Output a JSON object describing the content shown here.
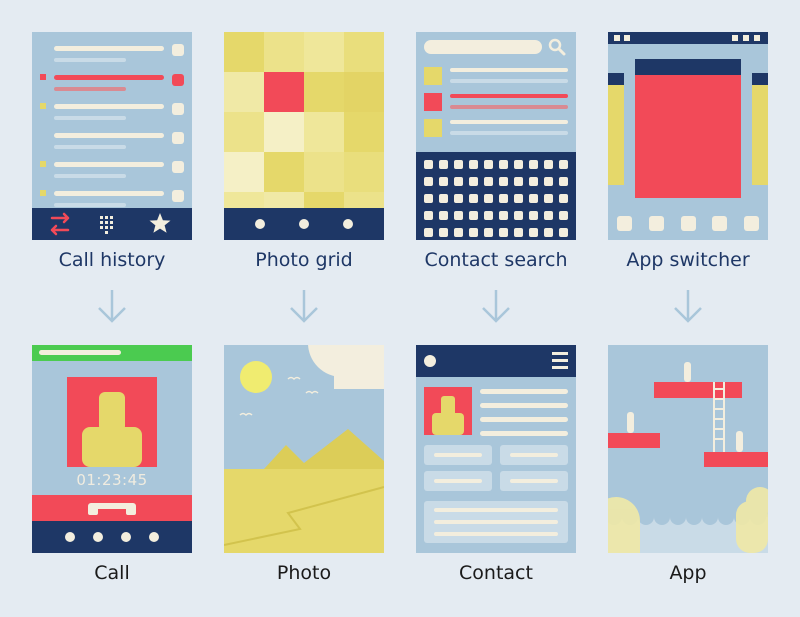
{
  "top_labels": {
    "call_history": "Call history",
    "photo_grid": "Photo grid",
    "contact_search": "Contact search",
    "app_switcher": "App switcher"
  },
  "bottom_labels": {
    "call": "Call",
    "photo": "Photo",
    "contact": "Contact",
    "app": "App"
  },
  "call": {
    "timer": "01:23:45"
  },
  "colors": {
    "background": "#e4ebf2",
    "screen": "#a9c6da",
    "navy": "#1e3766",
    "red": "#f24a58",
    "yellow": "#e5d86a",
    "cream": "#f3eede",
    "green": "#4bcb50",
    "arrow": "#a9c6da"
  },
  "icons": {
    "call_history_nav": [
      "swap-arrows-icon",
      "dialpad-icon",
      "star-icon"
    ],
    "contact_search": "search-icon",
    "contact_header": "hamburger-menu-icon",
    "call": "hang-up-icon"
  }
}
